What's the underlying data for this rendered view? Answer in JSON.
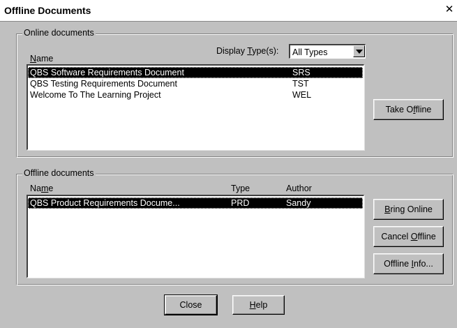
{
  "window": {
    "title": "Offline Documents",
    "close_glyph": "✕"
  },
  "online": {
    "legend": "Online documents",
    "col_name": "Name",
    "display_type_label": "Display Type(s):",
    "display_type_value": "All Types",
    "rows": [
      {
        "name": "QBS Software Requirements Document",
        "code": "SRS",
        "selected": true
      },
      {
        "name": "QBS Testing Requirements Document",
        "code": "TST",
        "selected": false
      },
      {
        "name": "Welcome To The Learning Project",
        "code": "WEL",
        "selected": false
      }
    ],
    "take_offline": "Take Offline"
  },
  "offline": {
    "legend": "Offline documents",
    "col_name": "Name",
    "col_type": "Type",
    "col_author": "Author",
    "rows": [
      {
        "name": "QBS Product Requirements Docume...",
        "type": "PRD",
        "author": "Sandy",
        "selected": true
      }
    ],
    "bring_online": "Bring Online",
    "cancel_offline": "Cancel Offline",
    "offline_info": "Offline Info..."
  },
  "footer": {
    "close": "Close",
    "help": "Help"
  }
}
